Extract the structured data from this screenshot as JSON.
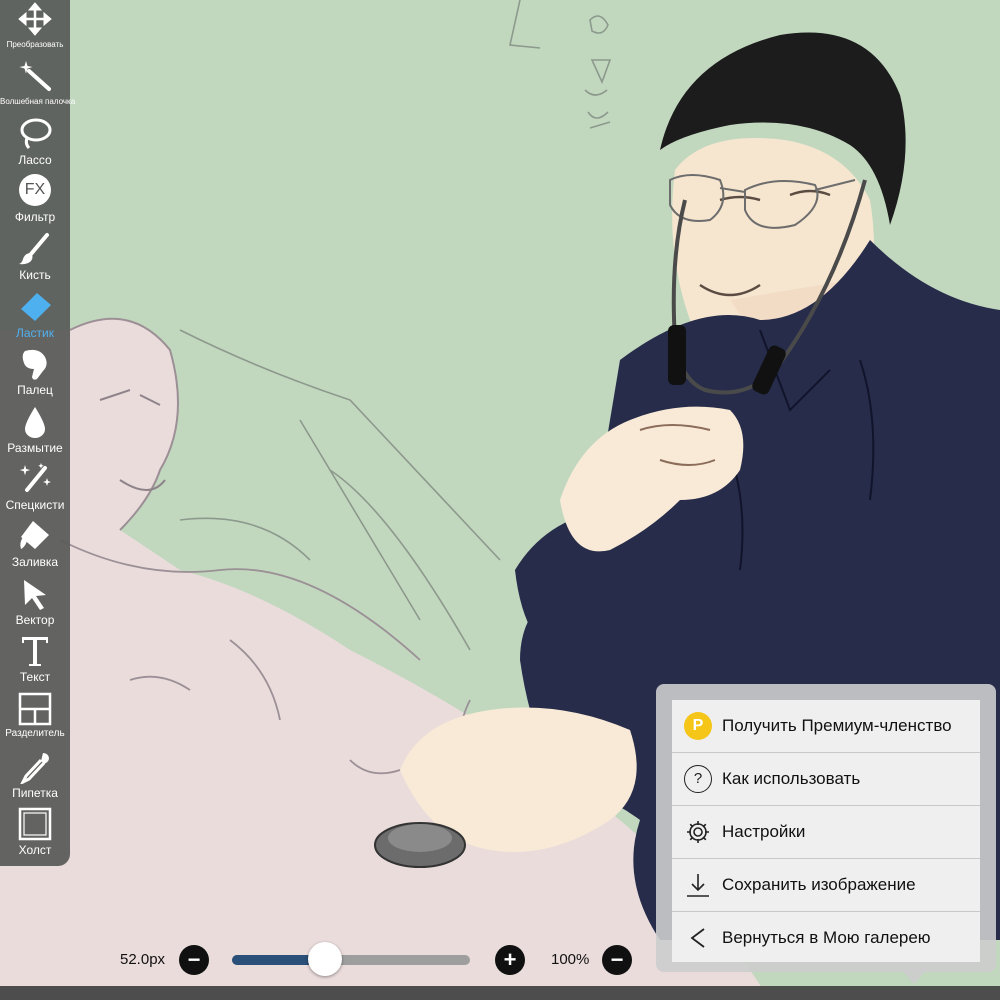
{
  "toolbar": {
    "tools": [
      {
        "label": "Преобразовать",
        "icon": "move-arrows-icon"
      },
      {
        "label": "Волшебная палочка",
        "icon": "magic-wand-icon"
      },
      {
        "label": "Лассо",
        "icon": "lasso-icon"
      },
      {
        "label": "Фильтр",
        "icon": "fx-filter-icon"
      },
      {
        "label": "Кисть",
        "icon": "brush-icon"
      },
      {
        "label": "Ластик",
        "icon": "eraser-icon",
        "active": true
      },
      {
        "label": "Палец",
        "icon": "smudge-finger-icon"
      },
      {
        "label": "Размытие",
        "icon": "blur-drop-icon"
      },
      {
        "label": "Спецкисти",
        "icon": "special-brush-icon"
      },
      {
        "label": "Заливка",
        "icon": "bucket-fill-icon"
      },
      {
        "label": "Вектор",
        "icon": "cursor-arrow-icon"
      },
      {
        "label": "Текст",
        "icon": "text-t-icon"
      },
      {
        "label": "Разделитель",
        "icon": "frame-divider-icon"
      },
      {
        "label": "Пипетка",
        "icon": "eyedropper-icon"
      },
      {
        "label": "Холст",
        "icon": "canvas-frame-icon"
      }
    ],
    "fx_text": "FX"
  },
  "bottom_bar": {
    "brush_size": "52.0px",
    "minus": "−",
    "plus": "+",
    "zoom": "100%",
    "size_slider_value": 0.39
  },
  "menu": {
    "items": [
      {
        "label": "Получить Премиум-членство",
        "icon": "premium-p-icon",
        "icon_text": "P"
      },
      {
        "label": "Как использовать",
        "icon": "help-question-icon",
        "icon_text": "?"
      },
      {
        "label": "Настройки",
        "icon": "settings-gear-icon"
      },
      {
        "label": "Сохранить изображение",
        "icon": "download-save-icon"
      },
      {
        "label": "Вернуться в Мою галерею",
        "icon": "back-chevron-icon"
      }
    ]
  },
  "colors": {
    "canvas_background": "#c1d8bf",
    "active_tool": "#4fb0ef",
    "slider_fill": "#2a4f78",
    "premium_badge": "#f5c518"
  }
}
